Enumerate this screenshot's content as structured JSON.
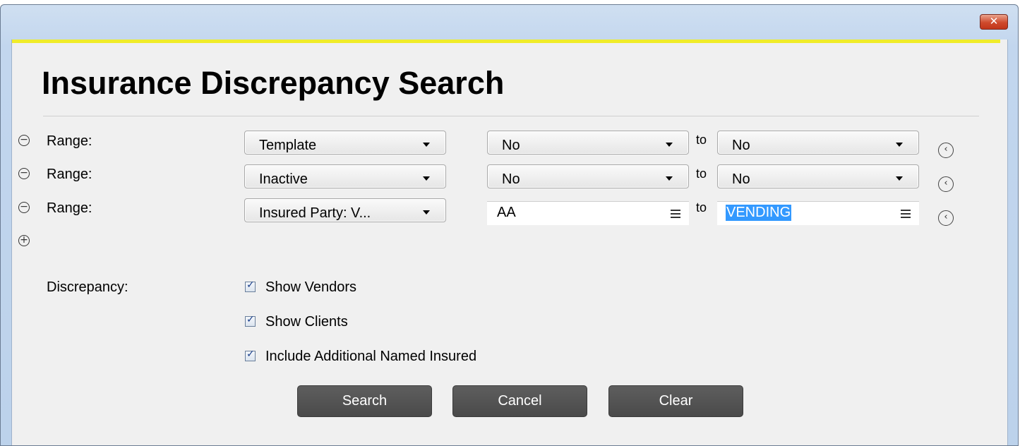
{
  "window": {
    "close_glyph": "✕"
  },
  "page": {
    "title": "Insurance Discrepancy Search"
  },
  "ranges": [
    {
      "label": "Range:",
      "field": "Template",
      "from": "No",
      "to_label": "to",
      "to": "No"
    },
    {
      "label": "Range:",
      "field": "Inactive",
      "from": "No",
      "to_label": "to",
      "to": "No"
    },
    {
      "label": "Range:",
      "field": "Insured Party: V...",
      "from": "AA",
      "to_label": "to",
      "to": "VENDING"
    }
  ],
  "discrepancy": {
    "label": "Discrepancy:",
    "options": [
      {
        "label": "Show Vendors",
        "checked": true
      },
      {
        "label": "Show Clients",
        "checked": true
      },
      {
        "label": "Include Additional Named Insured",
        "checked": true
      }
    ]
  },
  "buttons": {
    "search": "Search",
    "cancel": "Cancel",
    "clear": "Clear"
  },
  "icons": {
    "remove": "minus-circle-icon",
    "add": "plus-circle-icon",
    "reset": "chevron-left-circle-icon",
    "lookup": "list-menu-icon"
  },
  "colors": {
    "accent_bar": "#f0ec2a",
    "selection": "#3399ff",
    "button": "#555555"
  }
}
